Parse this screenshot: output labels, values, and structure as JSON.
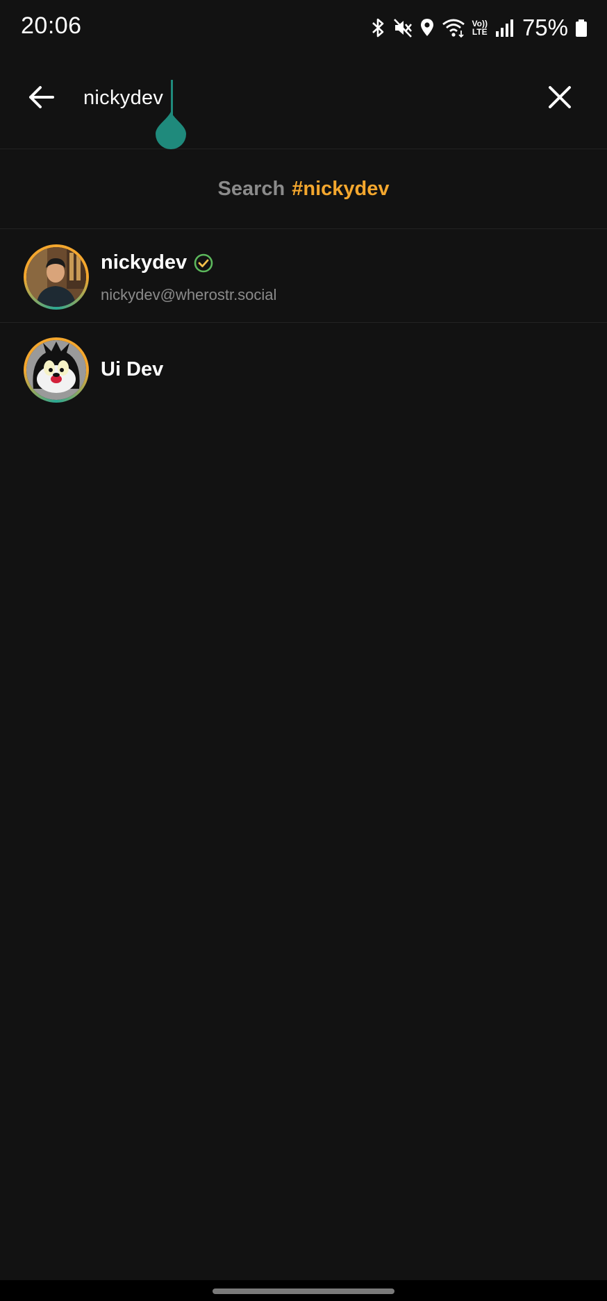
{
  "status_bar": {
    "time": "20:06",
    "battery_percent": "75%",
    "network_label_top": "Vo))",
    "network_label_bottom": "LTE",
    "icons": [
      "bluetooth-icon",
      "mute-icon",
      "location-icon",
      "wifi-icon",
      "volte-icon",
      "signal-icon",
      "battery-icon"
    ]
  },
  "search": {
    "query": "nickydev",
    "back_icon": "arrow-left-icon",
    "clear_icon": "close-icon",
    "accent": "#1f8a7c"
  },
  "hashtag_suggestion": {
    "prefix": "Search",
    "tag": "#nickydev",
    "tag_color": "#f4a72e"
  },
  "results": [
    {
      "name": "nickydev",
      "handle": "nickydev@wherostr.social",
      "verified": true,
      "verified_color": "#5cb85c"
    },
    {
      "name": "Ui Dev",
      "handle": "",
      "verified": false
    }
  ],
  "colors": {
    "background": "#121212",
    "divider": "#232323",
    "secondary_text": "#8b8b8b",
    "avatar_ring_gold": "#f4a72e",
    "avatar_ring_teal": "#2aa893"
  }
}
